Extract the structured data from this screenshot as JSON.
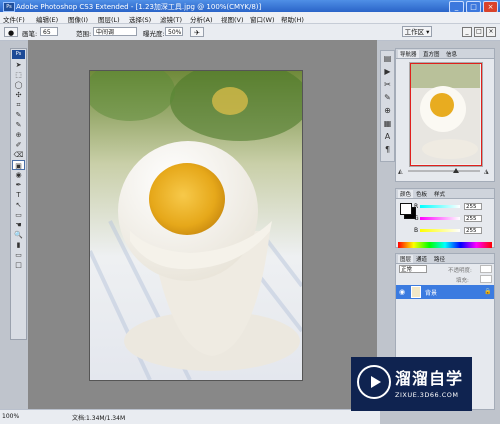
{
  "window": {
    "title": "Adobe Photoshop CS3 Extended - [1.23加深工具.jpg @ 100%(CMYK/8)]",
    "controls": [
      "_",
      "□",
      "×"
    ]
  },
  "menu": [
    "文件(F)",
    "编辑(E)",
    "图像(I)",
    "图层(L)",
    "选择(S)",
    "滤镜(T)",
    "分析(A)",
    "视图(V)",
    "窗口(W)",
    "帮助(H)"
  ],
  "options": {
    "brush_label": "画笔:",
    "brush_size": "65",
    "range_label": "范围:",
    "range_value": "中间调",
    "exposure_label": "曝光度:",
    "exposure_value": "50%",
    "workspace": "工作区 ▾"
  },
  "toolbox": {
    "logo": "Ps",
    "tools": [
      "➤",
      "⬚",
      "◯",
      "✣",
      "⌗",
      "✎",
      "✎",
      "⊕",
      "✐",
      "⌫",
      "▣",
      "◉",
      "✒",
      "T",
      "↖",
      "▭",
      "☚",
      "🔍",
      "▮",
      "▭",
      "□"
    ],
    "selected_index": 10
  },
  "status": {
    "zoom": "100%",
    "doc": "文档:1.34M/1.34M"
  },
  "navigator": {
    "tabs": [
      "导航器",
      "直方图",
      "信息"
    ]
  },
  "color_panel": {
    "tabs": [
      "颜色",
      "色板",
      "样式"
    ],
    "channels": [
      {
        "label": "R",
        "value": "255"
      },
      {
        "label": "G",
        "value": "255"
      },
      {
        "label": "B",
        "value": "255"
      }
    ]
  },
  "layers_panel": {
    "tabs": [
      "图层",
      "通道",
      "路径"
    ],
    "blend_mode": "正常",
    "opacity_label": "不透明度:",
    "fill_label": "填充:",
    "layer_name": "背景"
  },
  "watermark": {
    "brand": "溜溜自学",
    "url": "ZIXUE.3D66.COM"
  },
  "colors": {
    "title_bar": "#2a64c8",
    "selection_red": "#e0201c",
    "layer_highlight": "#3b7be0"
  }
}
